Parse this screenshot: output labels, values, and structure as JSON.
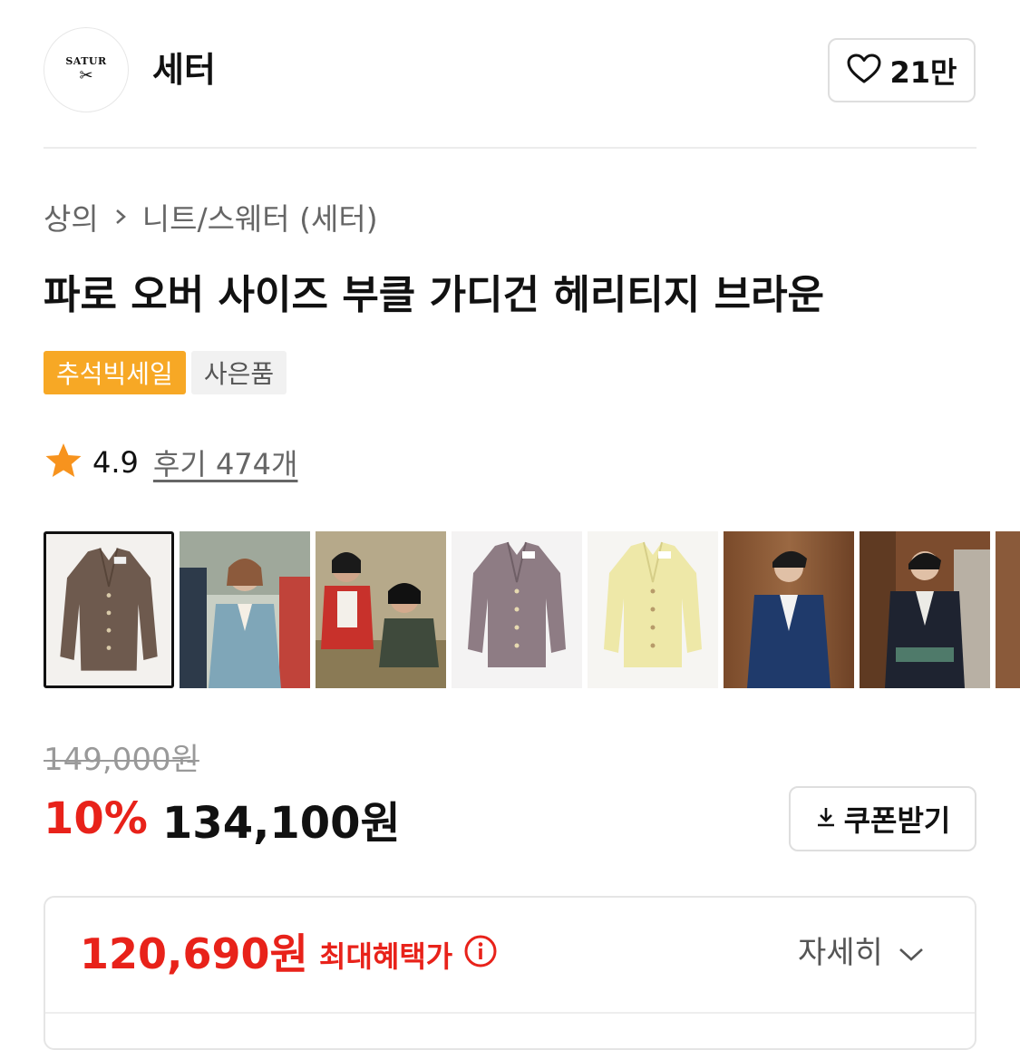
{
  "brand": {
    "logo_text": "SATUR",
    "name": "세터",
    "like_count": "21만"
  },
  "breadcrumb": {
    "items": [
      "상의",
      "니트/스웨터 (세터)"
    ]
  },
  "product": {
    "title": "파로 오버 사이즈 부클 가디건 헤리티지 브라운",
    "badges": [
      "추석빅세일",
      "사은품"
    ],
    "rating": "4.9",
    "reviews": "후기 474개"
  },
  "thumbnails": [
    {
      "name": "brown-cardigan",
      "selected": true
    },
    {
      "name": "models-blue-cardigan",
      "selected": false
    },
    {
      "name": "models-red-cardigan",
      "selected": false
    },
    {
      "name": "purple-cardigan",
      "selected": false
    },
    {
      "name": "yellow-cardigan",
      "selected": false
    },
    {
      "name": "model-navy-cardigan",
      "selected": false
    },
    {
      "name": "model-black-cardigan",
      "selected": false
    },
    {
      "name": "partial-image",
      "selected": false
    }
  ],
  "price": {
    "original": "149,000원",
    "discount": "10%",
    "current": "134,100원",
    "coupon_label": "쿠폰받기"
  },
  "benefit": {
    "price": "120,690원",
    "label": "최대혜택가",
    "detail_label": "자세히"
  },
  "colors": {
    "accent_red": "#e8221a",
    "badge_orange": "#f7a825",
    "star": "#f7931e"
  }
}
